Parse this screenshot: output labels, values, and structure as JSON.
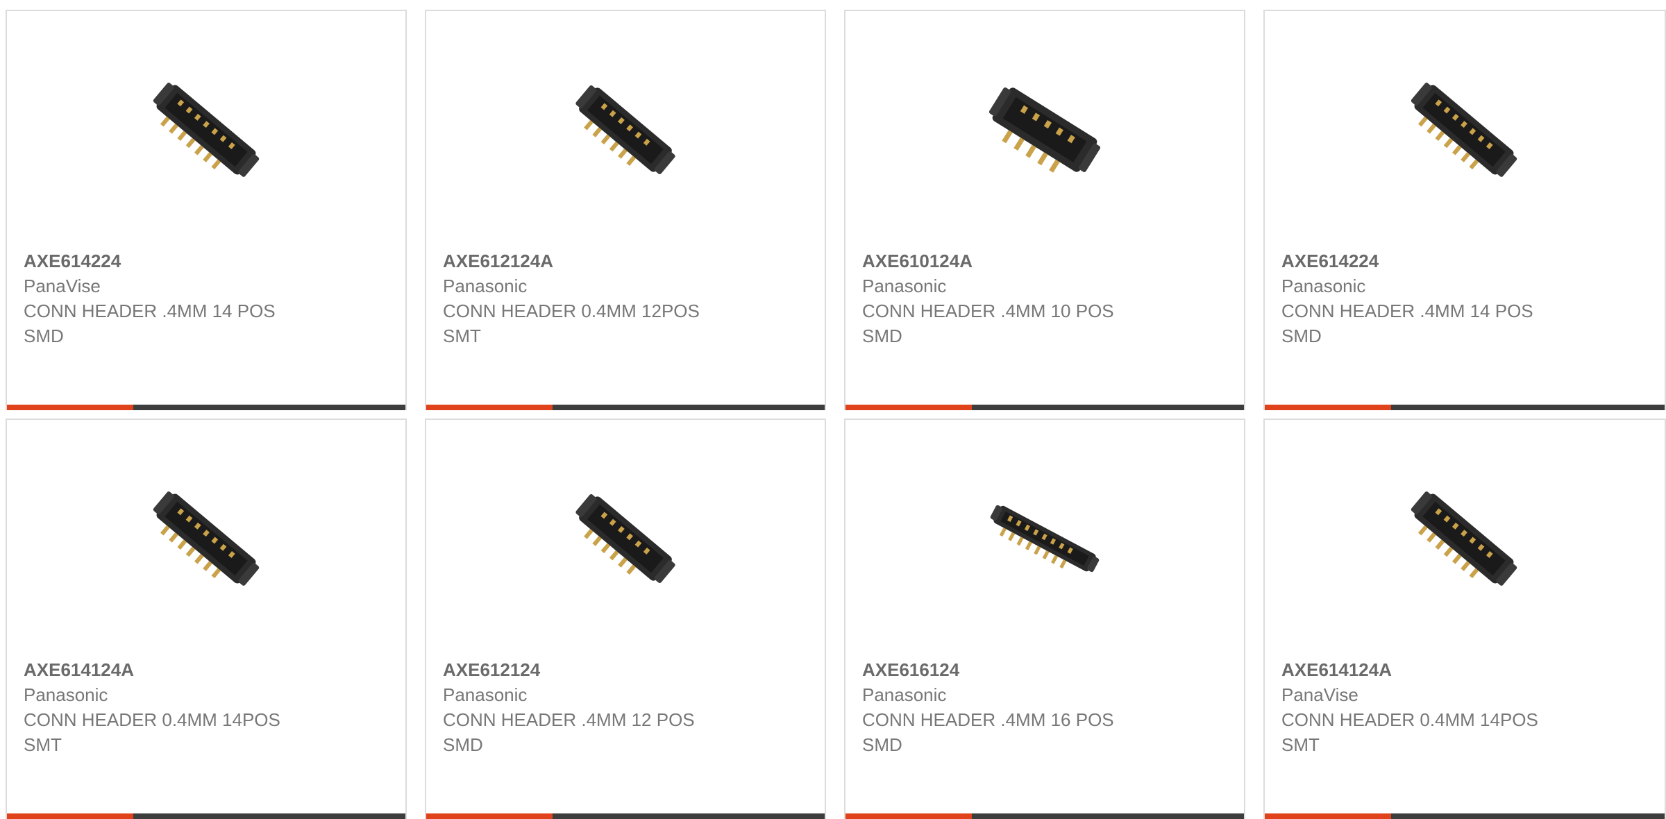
{
  "products": [
    {
      "part_number": "AXE614224",
      "manufacturer": "PanaVise",
      "description_line1": "CONN HEADER .4MM 14 POS",
      "description_line2": "SMD",
      "image_icon": "connector-header-image"
    },
    {
      "part_number": "AXE612124A",
      "manufacturer": "Panasonic",
      "description_line1": "CONN HEADER 0.4MM 12POS",
      "description_line2": "SMT",
      "image_icon": "connector-header-image"
    },
    {
      "part_number": "AXE610124A",
      "manufacturer": "Panasonic",
      "description_line1": "CONN HEADER .4MM 10 POS",
      "description_line2": "SMD",
      "image_icon": "connector-header-image"
    },
    {
      "part_number": "AXE614224",
      "manufacturer": "Panasonic",
      "description_line1": "CONN HEADER .4MM 14 POS",
      "description_line2": "SMD",
      "image_icon": "connector-header-image"
    },
    {
      "part_number": "AXE614124A",
      "manufacturer": "Panasonic",
      "description_line1": "CONN HEADER 0.4MM 14POS",
      "description_line2": "SMT",
      "image_icon": "connector-header-image"
    },
    {
      "part_number": "AXE612124",
      "manufacturer": "Panasonic",
      "description_line1": "CONN HEADER .4MM 12 POS",
      "description_line2": "SMD",
      "image_icon": "connector-header-image"
    },
    {
      "part_number": "AXE616124",
      "manufacturer": "Panasonic",
      "description_line1": "CONN HEADER .4MM 16 POS",
      "description_line2": "SMD",
      "image_icon": "connector-header-image"
    },
    {
      "part_number": "AXE614124A",
      "manufacturer": "PanaVise",
      "description_line1": "CONN HEADER 0.4MM 14POS",
      "description_line2": "SMT",
      "image_icon": "connector-header-image"
    }
  ],
  "colors": {
    "accent": "#e0421b",
    "bar": "#3d3d3d",
    "border": "#dcdcdc",
    "text": "#777777"
  }
}
